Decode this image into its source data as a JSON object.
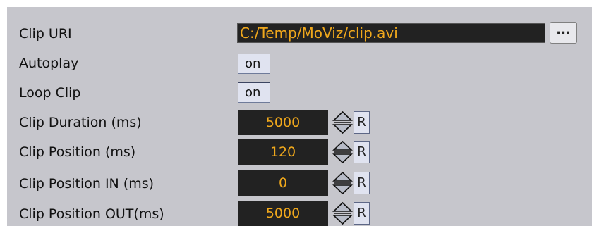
{
  "rows": {
    "clip_uri": {
      "label": "Clip URI",
      "value": "C:/Temp/MoViz/clip.avi",
      "browse_label": "..."
    },
    "autoplay": {
      "label": "Autoplay",
      "value": "on"
    },
    "loop_clip": {
      "label": "Loop Clip",
      "value": "on"
    },
    "clip_duration": {
      "label": "Clip Duration (ms)",
      "value": "5000",
      "reset_label": "R"
    },
    "clip_position": {
      "label": "Clip Position (ms)",
      "value": "120",
      "reset_label": "R"
    },
    "clip_position_in": {
      "label": "Clip Position IN (ms)",
      "value": "0",
      "reset_label": "R"
    },
    "clip_position_out": {
      "label": "Clip Position OUT(ms)",
      "value": "5000",
      "reset_label": "R"
    }
  },
  "colors": {
    "panel_background": "#c6c6cc",
    "field_background": "#222222",
    "field_text": "#f0a81c",
    "toggle_background": "#e0e3f0"
  },
  "icons": {
    "spinner": "up-down-arrows-icon"
  }
}
